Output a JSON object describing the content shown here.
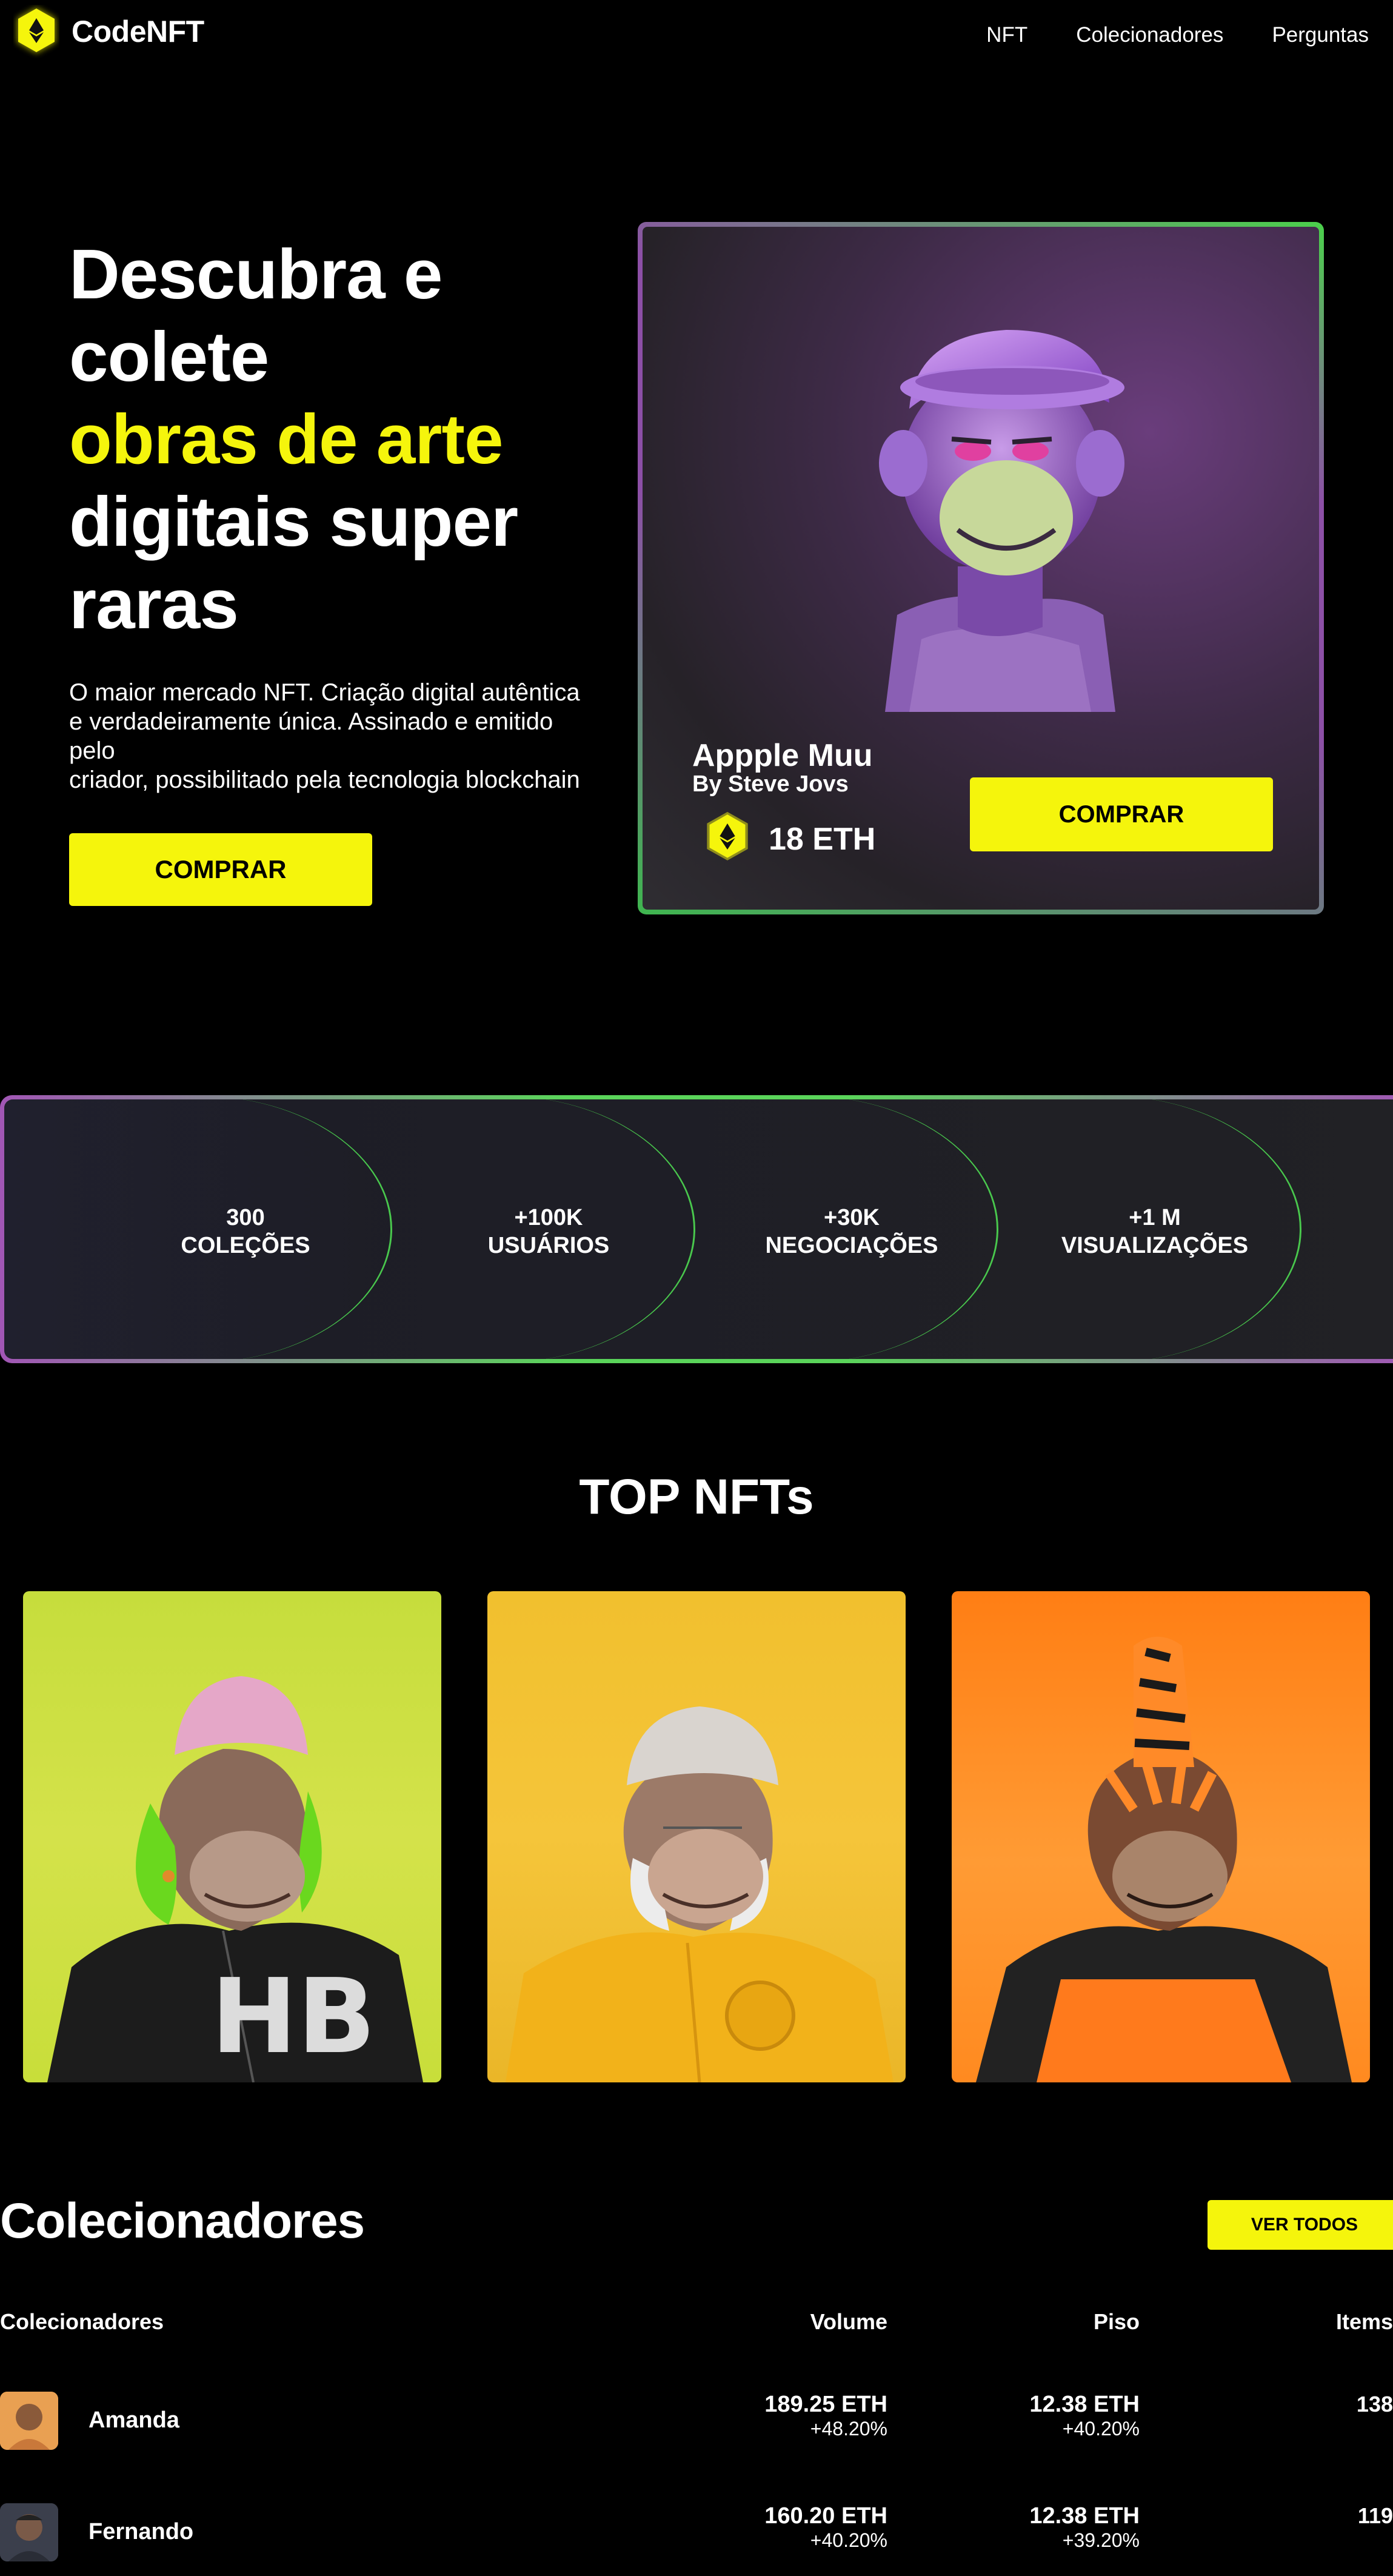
{
  "brand": {
    "name": "CodeNFT",
    "accent": "#f5f50c"
  },
  "nav": {
    "links": [
      "NFT",
      "Colecionadores",
      "Perguntas"
    ]
  },
  "hero": {
    "title_line1": "Descubra e",
    "title_line2": "colete",
    "title_highlight": "obras de arte",
    "title_line4": "digitais super",
    "title_line5": "raras",
    "subtitle_lines": [
      "O maior mercado NFT. Criação digital autêntica",
      "e verdadeiramente única. Assinado e emitido",
      "pelo",
      "criador, possibilitado pela tecnologia blockchain"
    ],
    "button": "COMPRAR"
  },
  "featured": {
    "name": "Appple Muu",
    "author": "By Steve Jovs",
    "price": "18 ETH",
    "button": "COMPRAR"
  },
  "stats": [
    {
      "value": "300",
      "label": "COLEÇÕES"
    },
    {
      "value": "+100K",
      "label": "USUÁRIOS"
    },
    {
      "value": "+30K",
      "label": "NEGOCIAÇÕES"
    },
    {
      "value": "+1 M",
      "label": "VISUALIZAÇÕES"
    }
  ],
  "top_nfts": {
    "title": "TOP NFTs"
  },
  "collectors": {
    "title": "Colecionadores",
    "view_all": "VER TODOS",
    "headers": {
      "name": "Colecionadores",
      "volume": "Volume",
      "floor": "Piso",
      "items": "Items"
    },
    "rows": [
      {
        "name": "Amanda",
        "volume": "189.25 ETH",
        "volume_change": "+48.20%",
        "floor": "12.38 ETH",
        "floor_change": "+40.20%",
        "items": "138"
      },
      {
        "name": "Fernando",
        "volume": "160.20 ETH",
        "volume_change": "+40.20%",
        "floor": "12.38 ETH",
        "floor_change": "+39.20%",
        "items": "119"
      }
    ]
  }
}
